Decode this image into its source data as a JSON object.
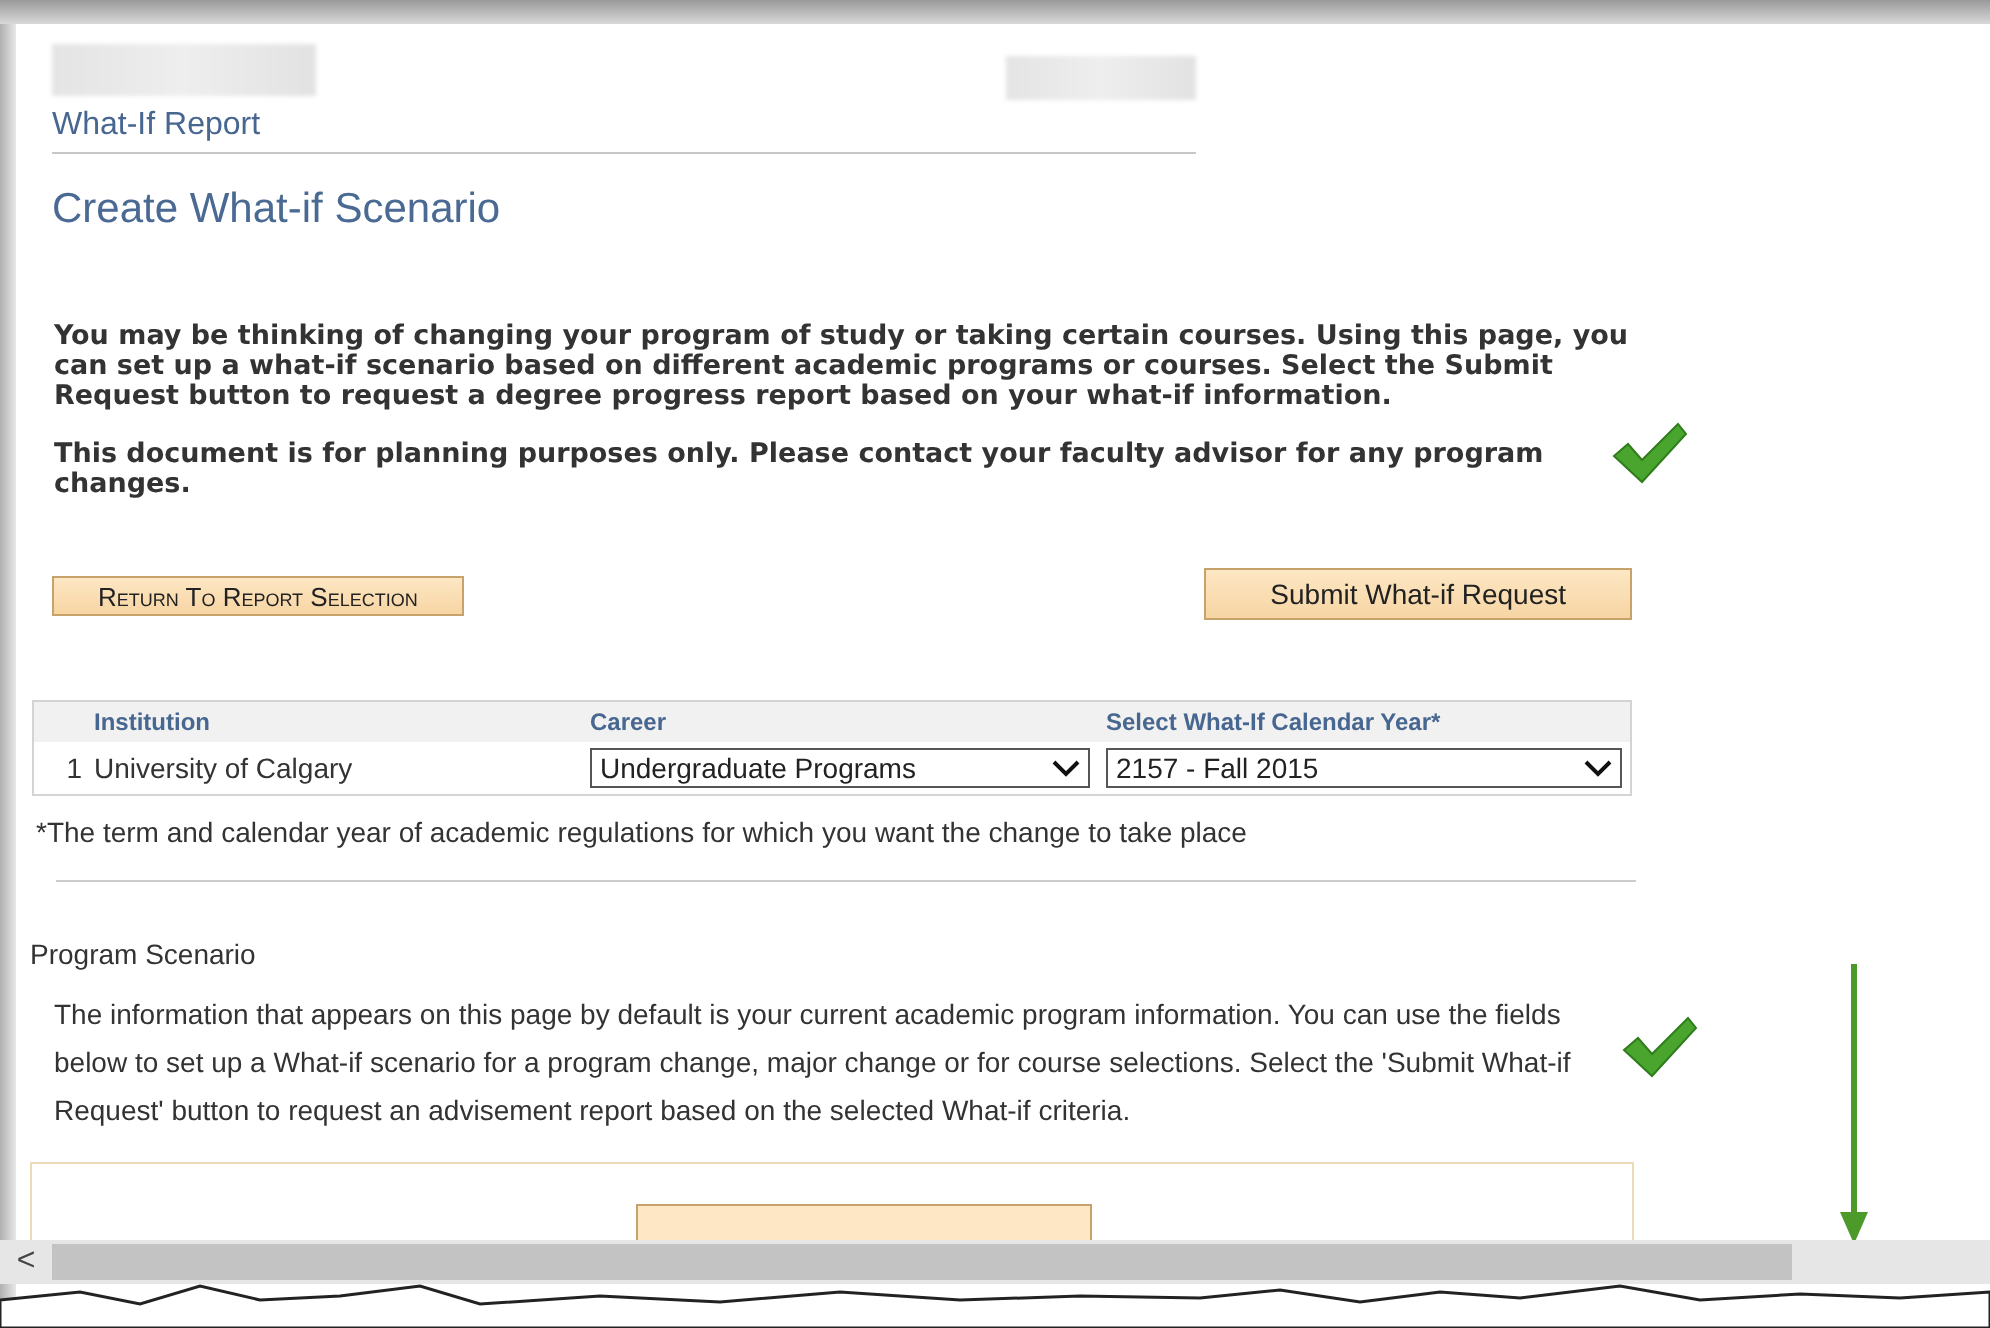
{
  "header": {
    "breadcrumb": "What-If Report",
    "title": "Create What-if Scenario"
  },
  "intro": [
    "You may be thinking of changing your program of study or taking certain courses. Using this page, you can set up a what-if scenario based on different academic programs or courses. Select the Submit Request button to request a degree progress report based on your what-if information.",
    "This document is for planning purposes only.  Please contact your faculty advisor for any program changes."
  ],
  "buttons": [
    {
      "label": "Return To Report Selection",
      "kind": "smallcaps"
    },
    {
      "label": "Submit What-if Request",
      "kind": "plain"
    }
  ],
  "table": {
    "columns": [
      "Institution",
      "Career",
      "Select What-If Calendar Year*"
    ],
    "rows": [
      {
        "number": "1",
        "institution": "University of Calgary",
        "career": "Undergraduate Programs",
        "calendar_year": "2157 - Fall 2015"
      }
    ]
  },
  "footnote": "*The term and calendar year of academic regulations for which you want the change to take place",
  "program_scenario": {
    "heading": "Program Scenario",
    "text": "The information that appears on this page by default is your current academic program information. You can use the fields below to set up a What-if scenario for a program change, major change or for course selections. Select the 'Submit What-if Request' button to request an advisement report based on the selected What-if criteria."
  },
  "scrollbar_arrow": "<"
}
